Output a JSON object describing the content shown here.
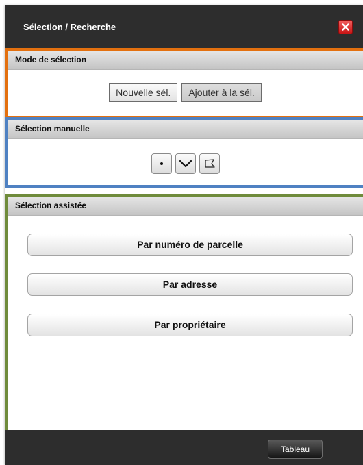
{
  "dialog": {
    "title": "Sélection / Recherche",
    "close_icon": "close-icon",
    "close_color": "#e02020"
  },
  "mode_section": {
    "title": "Mode de sélection",
    "border_color": "#e3700f",
    "buttons": [
      {
        "label": "Nouvelle sél.",
        "active": false
      },
      {
        "label": "Ajouter à la sél.",
        "active": true
      }
    ]
  },
  "manual_section": {
    "title": "Sélection manuelle",
    "border_color": "#4f81c2",
    "tools": [
      {
        "icon": "point-icon"
      },
      {
        "icon": "polyline-icon"
      },
      {
        "icon": "polygon-icon"
      }
    ]
  },
  "assist_section": {
    "title": "Sélection assistée",
    "border_color": "#6f8b3b",
    "buttons": [
      {
        "label": "Par numéro de parcelle"
      },
      {
        "label": "Par adresse"
      },
      {
        "label": "Par propriétaire"
      }
    ]
  },
  "footer": {
    "table_button": "Tableau"
  }
}
